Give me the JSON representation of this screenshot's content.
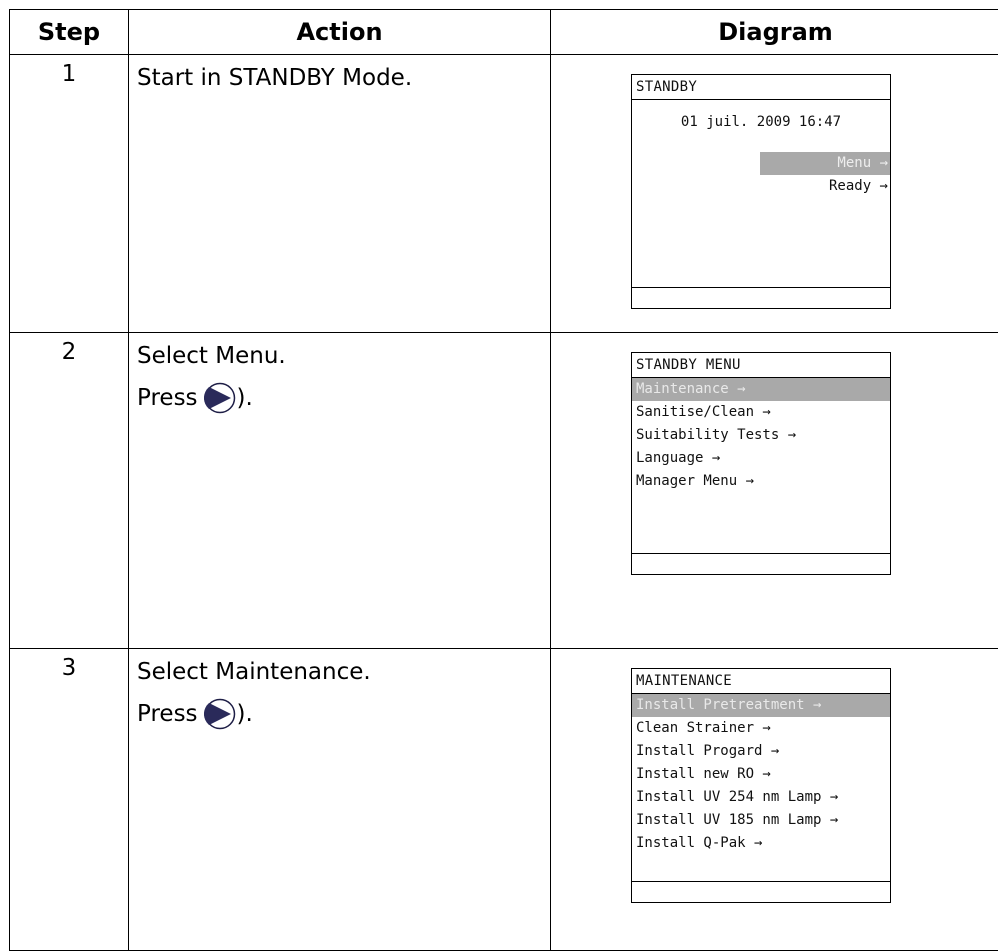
{
  "headers": {
    "step": "Step",
    "action": "Action",
    "diagram": "Diagram"
  },
  "rows": [
    {
      "step": "1",
      "action": "Start in STANDBY Mode.",
      "screen": {
        "title": "STANDBY",
        "date": "01 juil. 2009 16:47",
        "items": [
          "Menu →",
          "Ready →"
        ]
      }
    },
    {
      "step": "2",
      "action": "Select Menu.",
      "press": "Press",
      "press_suffix": ").",
      "screen": {
        "title": "STANDBY MENU",
        "items": [
          "Maintenance →",
          "Sanitise/Clean →",
          "Suitability Tests →",
          "Language →",
          "Manager Menu →"
        ]
      }
    },
    {
      "step": "3",
      "action": "Select Maintenance.",
      "press": "Press",
      "press_suffix": ").",
      "screen": {
        "title": "MAINTENANCE",
        "items": [
          "Install Pretreatment →",
          "Clean Strainer →",
          "Install Progard →",
          "Install new RO →",
          "Install UV 254 nm Lamp →",
          "Install UV 185 nm Lamp →",
          "Install Q-Pak →"
        ]
      }
    }
  ],
  "colors": {
    "selection": "#a9a9a9",
    "button": "#2a2a5a"
  },
  "icons": {
    "press_button": "right-arrow-button-icon"
  }
}
